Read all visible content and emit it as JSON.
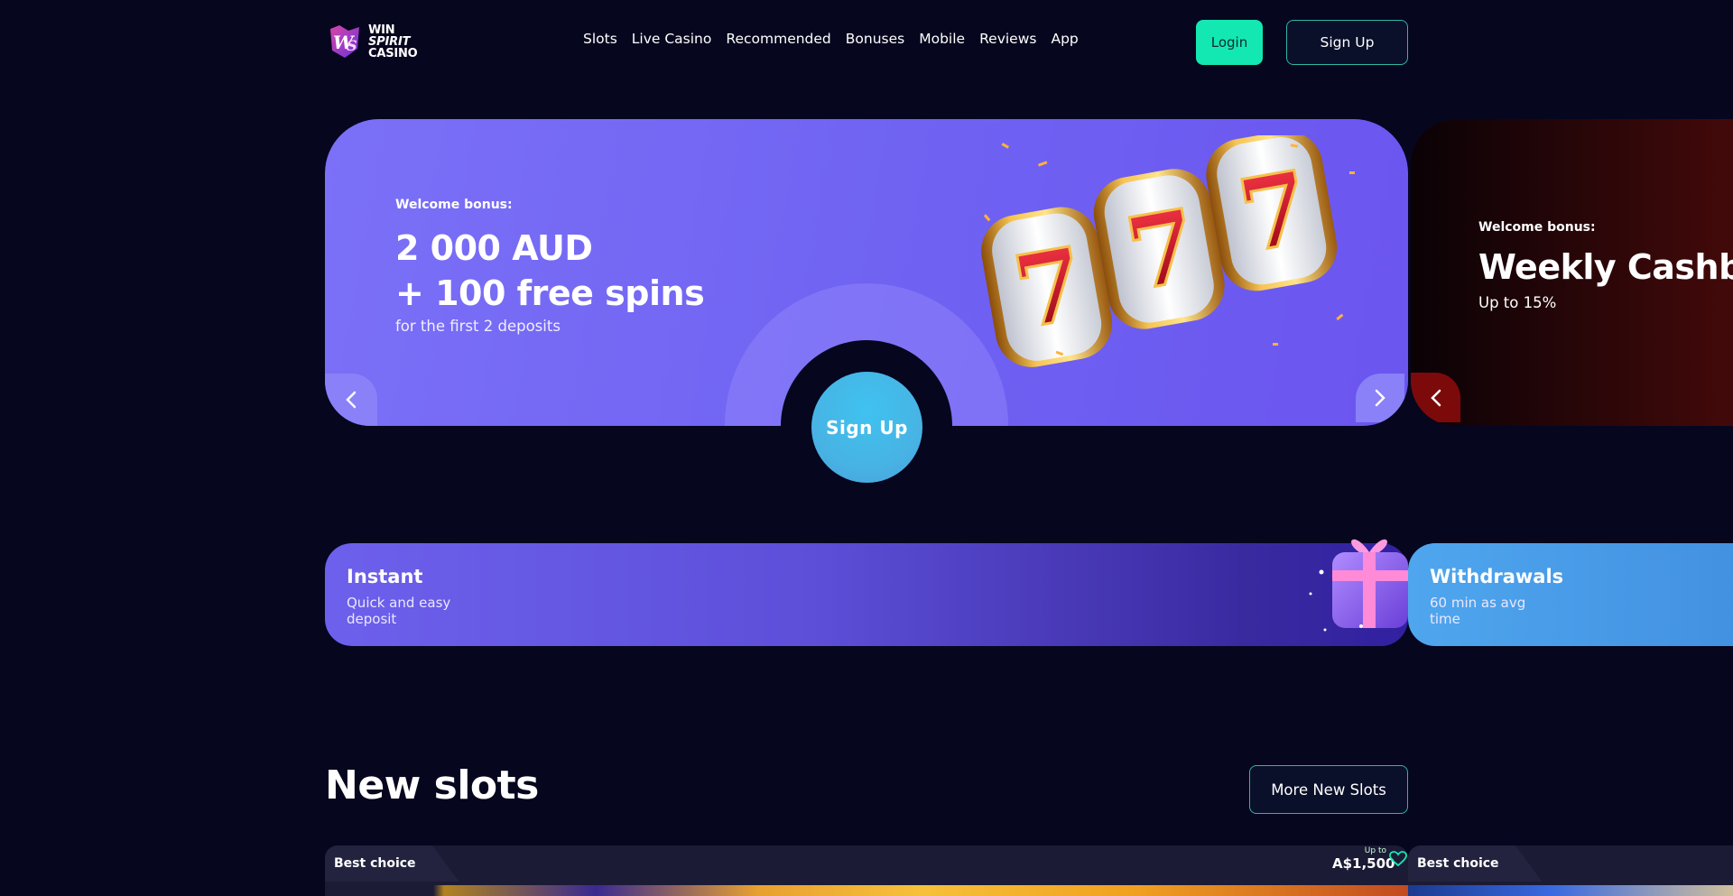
{
  "header": {
    "logo": {
      "line1": "WIN",
      "line2": "SPIRIT",
      "line3": "CASINO"
    },
    "nav": [
      "Slots",
      "Live Casino",
      "Recommended",
      "Bonuses",
      "Mobile",
      "Reviews",
      "App"
    ],
    "login_label": "Login",
    "signup_label": "Sign Up"
  },
  "hero": {
    "label": "Welcome bonus:",
    "title_line1": "2 000 AUD",
    "title_line2": "+ 100 free spins",
    "subtitle": "for the first 2 deposits",
    "cta_label": "Sign Up",
    "prev_icon": "chevron-left-icon",
    "next_icon": "chevron-right-icon"
  },
  "hero2": {
    "label": "Welcome bonus:",
    "title": "Weekly Cashback",
    "subtitle": "Up to 15%"
  },
  "features": [
    {
      "title": "Instant",
      "subtitle": "Quick and easy deposit"
    },
    {
      "title": "Withdrawals",
      "subtitle": "60 min as avg time"
    }
  ],
  "new_slots": {
    "title": "New slots",
    "more_label": "More New Slots",
    "cards": [
      {
        "badge": "Best choice",
        "upto_label": "Up to",
        "upto_value": "A$1,500"
      },
      {
        "badge": "Best choice"
      }
    ]
  },
  "colors": {
    "background": "#06061f",
    "accent_green": "#14e8b2",
    "hero_purple": "#7b70f7",
    "cta_blue": "#47b4e4",
    "cashback_red": "#4a0a0a",
    "withdrawals_blue": "#4fa6ee"
  }
}
